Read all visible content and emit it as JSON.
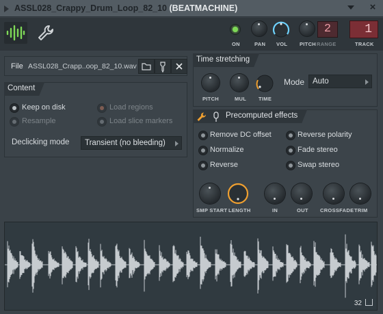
{
  "window": {
    "title_main": "ASSL028_Crappy_Drum_Loop_82_10",
    "title_sub": "(BEATMACHINE)"
  },
  "toolbar": {
    "on_label": "ON",
    "pan_label": "PAN",
    "vol_label": "VOL",
    "pitch_label": "PITCH",
    "range_label": "RANGE",
    "range_value": "2",
    "track_label": "TRACK",
    "track_value": "1",
    "accent_color": "#6fd3ff",
    "on_color": "#7ed957"
  },
  "file": {
    "label": "File",
    "name": "ASSL028_Crapp..oop_82_10.wav"
  },
  "content": {
    "title": "Content",
    "keep_on_disk": "Keep on disk",
    "resample": "Resample",
    "load_regions": "Load regions",
    "load_slice_markers": "Load slice markers",
    "declicking_label": "Declicking mode",
    "declicking_value": "Transient (no bleeding)"
  },
  "time_stretching": {
    "title": "Time stretching",
    "pitch": "PITCH",
    "mul": "MUL",
    "time": "TIME",
    "mode_label": "Mode",
    "mode_value": "Auto"
  },
  "precomputed": {
    "title": "Precomputed effects",
    "remove_dc": "Remove DC offset",
    "normalize": "Normalize",
    "reverse": "Reverse",
    "reverse_polarity": "Reverse polarity",
    "fade_stereo": "Fade stereo",
    "swap_stereo": "Swap stereo",
    "smp_start": "SMP START",
    "length": "LENGTH",
    "in": "IN",
    "out": "OUT",
    "crossfade": "CROSSFADE",
    "trim": "TRIM",
    "length_color": "#f0a030"
  },
  "waveform": {
    "zoom_value": "32",
    "color": "#c6cbcf"
  }
}
